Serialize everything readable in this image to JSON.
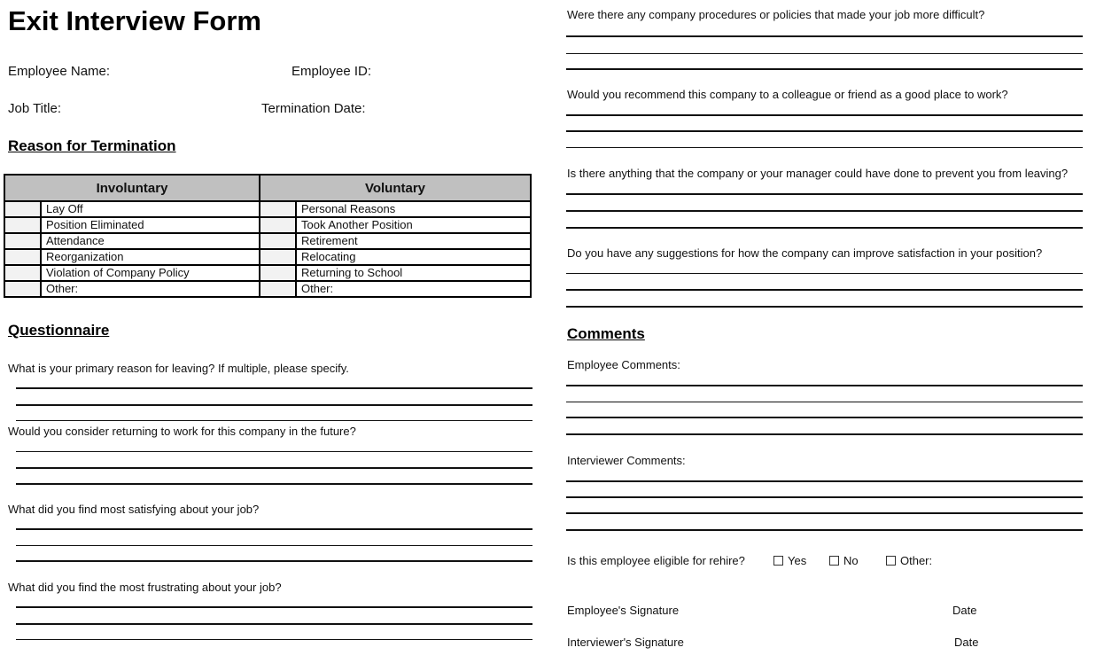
{
  "header": {
    "title": "Exit Interview Form",
    "employee_name_label": "Employee Name:",
    "employee_id_label": "Employee ID:",
    "job_title_label": "Job Title:",
    "termination_date_label": "Termination Date:"
  },
  "termination": {
    "heading": "Reason for Termination",
    "columns": [
      "Involuntary",
      "Voluntary"
    ],
    "involuntary": [
      "Lay Off",
      "Position Eliminated",
      "Attendance",
      "Reorganization",
      "Violation of Company Policy",
      "Other:"
    ],
    "voluntary": [
      "Personal Reasons",
      "Took Another Position",
      "Retirement",
      "Relocating",
      "Returning to School",
      "Other:"
    ]
  },
  "questionnaire": {
    "heading": "Questionnaire",
    "questions": [
      "What is your primary reason for leaving? If multiple, please specify.",
      "Would you consider returning to work for this company in the future?",
      "What did you find most satisfying about your job?",
      "What did you find the most frustrating about your job?",
      "Were there any company procedures or policies that made your job more difficult?",
      "Would you recommend this company to a colleague or friend as a good place to work?",
      "Is there anything that the company or your manager could have done to prevent you from leaving?",
      "Do you have any suggestions for how the company can improve satisfaction in your position?"
    ]
  },
  "comments": {
    "heading": "Comments",
    "employee_label": "Employee Comments:",
    "interviewer_label": "Interviewer Comments:"
  },
  "rehire": {
    "question": "Is this employee eligible for rehire?",
    "options": [
      "Yes",
      "No",
      "Other:"
    ]
  },
  "signatures": {
    "employee_label": "Employee's Signature",
    "interviewer_label": "Interviewer's Signature",
    "date_label": "Date"
  }
}
